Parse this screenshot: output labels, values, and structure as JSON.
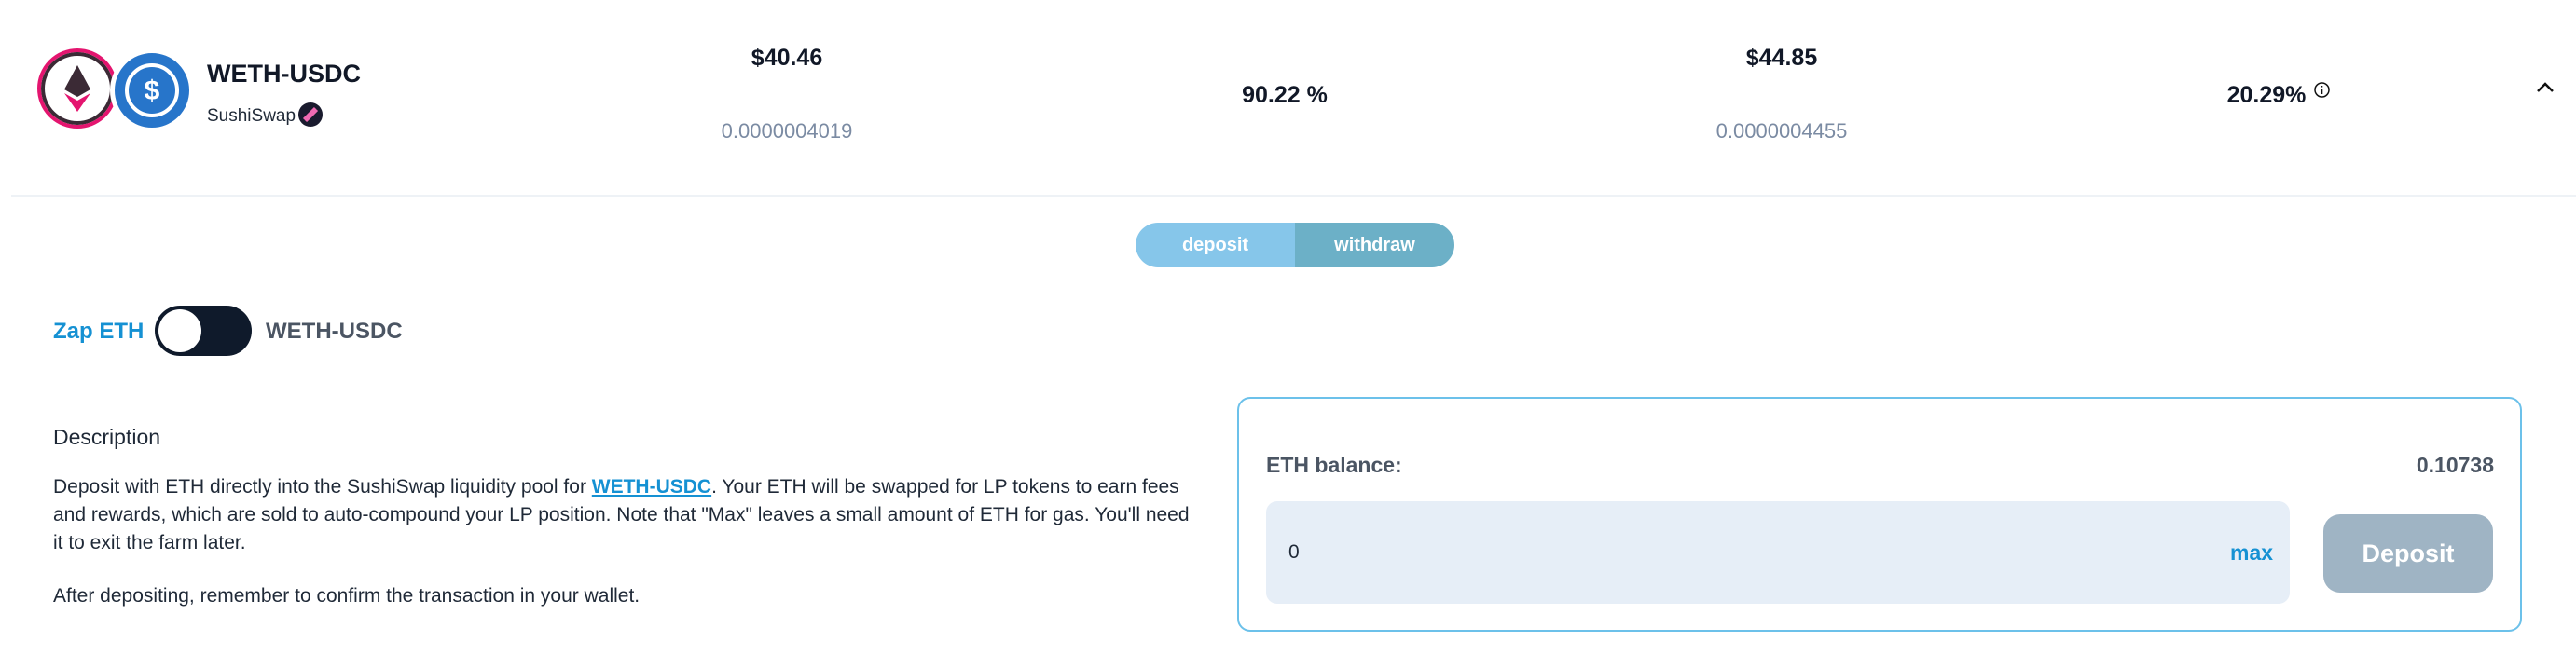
{
  "pair": {
    "name": "WETH-USDC",
    "platform": "SushiSwap"
  },
  "stats": {
    "deposit_usd": "$40.46",
    "deposit_lp": "0.0000004019",
    "ratio": "90.22 %",
    "value_usd": "$44.85",
    "value_lp": "0.0000004455",
    "apy": "20.29%"
  },
  "tabs": {
    "deposit": "deposit",
    "withdraw": "withdraw"
  },
  "zap": {
    "left_label": "Zap ETH",
    "right_label": "WETH-USDC"
  },
  "description": {
    "title": "Description",
    "before_link": "Deposit with ETH directly into the SushiSwap liquidity pool for ",
    "link": "WETH-USDC",
    "after_link": ". Your ETH will be swapped for LP tokens to earn fees and rewards, which are sold to auto-compound your LP position. Note that \"Max\" leaves a small amount of ETH for gas. You'll need it to exit the farm later.",
    "confirm": "After depositing, remember to confirm the transaction in your wallet."
  },
  "deposit_box": {
    "balance_label": "ETH balance:",
    "balance_value": "0.10738",
    "amount_value": "0",
    "max_label": "max",
    "deposit_button": "Deposit"
  },
  "colors": {
    "accent": "#1591d3",
    "usdc": "#2775ca",
    "eth_ring": "#e4156f",
    "switch_bg": "#0f1a2b"
  },
  "icons": [
    "eth-logo-icon",
    "usdc-logo-icon",
    "sushiswap-icon",
    "info-icon",
    "chevron-up-icon"
  ]
}
